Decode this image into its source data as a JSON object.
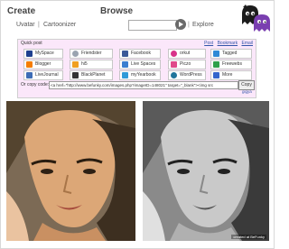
{
  "header": {
    "create_title": "Create",
    "browse_title": "Browse",
    "nav": {
      "uvatar": "Uvatar",
      "separator": "|",
      "cartoonizer": "Cartoonizer",
      "explore_separator": "|",
      "explore": "Explore"
    },
    "search": {
      "value": ""
    }
  },
  "quick_post": {
    "label": "Quick post",
    "links": {
      "post": "Post",
      "bookmark": "Bookmark",
      "email": "Email"
    },
    "sites": [
      {
        "label": "MySpace",
        "icon": "myspace-icon",
        "color": "#1e3f8f"
      },
      {
        "label": "Friendster",
        "icon": "friendster-icon",
        "color": "#9aa4b0"
      },
      {
        "label": "Facebook",
        "icon": "facebook-icon",
        "color": "#3b5998"
      },
      {
        "label": "orkut",
        "icon": "orkut-icon",
        "color": "#d8328a"
      },
      {
        "label": "Tagged",
        "icon": "tagged-icon",
        "color": "#2f8ad6"
      },
      {
        "label": "Blogger",
        "icon": "blogger-icon",
        "color": "#f57d00"
      },
      {
        "label": "hi5",
        "icon": "hi5-icon",
        "color": "#f0a020"
      },
      {
        "label": "Live Spaces",
        "icon": "live-spaces-icon",
        "color": "#3a7fd0"
      },
      {
        "label": "Piczo",
        "icon": "piczo-icon",
        "color": "#e04a8a"
      },
      {
        "label": "Freewebs",
        "icon": "freewebs-icon",
        "color": "#2ea04a"
      },
      {
        "label": "LiveJournal",
        "icon": "livejournal-icon",
        "color": "#3d6cb5"
      },
      {
        "label": "BlackPlanet",
        "icon": "blackplanet-icon",
        "color": "#333333"
      },
      {
        "label": "myYearbook",
        "icon": "myyearbook-icon",
        "color": "#2f9bd8"
      },
      {
        "label": "WordPress",
        "icon": "wordpress-icon",
        "color": "#21759b"
      },
      {
        "label": "More",
        "icon": "more-icon",
        "color": "#3366cc"
      }
    ],
    "copy_label": "Or copy code:",
    "copy_code": "<a href=\"http://www.befunky.com/images.php?imageID=148021\" target=\"_blank\"><img src",
    "copy_button": "Copy",
    "gigya": "gigya"
  },
  "images": {
    "credit": "created at BeFunky"
  },
  "colors": {
    "panel_bg": "#fbe7fa",
    "link": "#3355aa",
    "mascot_purple": "#7a3fb0",
    "mascot_black": "#1c1c1c"
  }
}
